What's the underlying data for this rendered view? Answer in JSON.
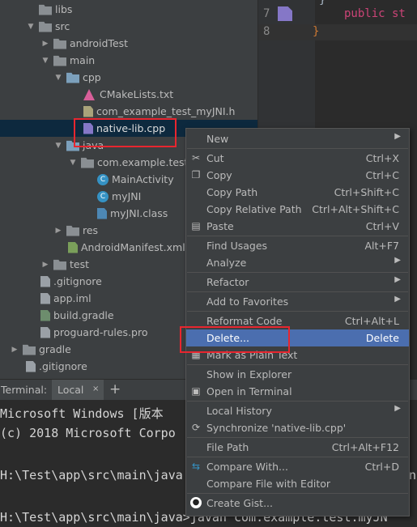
{
  "tree": {
    "items": [
      {
        "label": "libs"
      },
      {
        "label": "src"
      },
      {
        "label": "androidTest"
      },
      {
        "label": "main"
      },
      {
        "label": "cpp"
      },
      {
        "label": "CMakeLists.txt"
      },
      {
        "label": "com_example_test_myJNI.h"
      },
      {
        "label": "native-lib.cpp"
      },
      {
        "label": "java"
      },
      {
        "label": "com.example.test"
      },
      {
        "label": "MainActivity"
      },
      {
        "label": "myJNI"
      },
      {
        "label": "myJNI.class"
      },
      {
        "label": "res"
      },
      {
        "label": "AndroidManifest.xml"
      },
      {
        "label": "test"
      },
      {
        "label": ".gitignore"
      },
      {
        "label": "app.iml"
      },
      {
        "label": "build.gradle"
      },
      {
        "label": "proguard-rules.pro"
      },
      {
        "label": "gradle"
      },
      {
        "label": ".gitignore"
      }
    ]
  },
  "editor": {
    "line_numbers": [
      "7",
      "8"
    ],
    "code_line_7": "public st",
    "code_top": "}",
    "code_line_8": "}"
  },
  "terminal": {
    "label": "Terminal:",
    "tab": "Local",
    "add": "+",
    "lines": [
      "Microsoft Windows [版本",
      "(c) 2018 Microsoft Corpo",
      "",
      "H:\\Test\\app\\src\\main\\java",
      "",
      "H:\\Test\\app\\src\\main\\java>javah com.example.test.myJN"
    ],
    "overlap_char": "n"
  },
  "context_menu": {
    "items": [
      {
        "label": "New",
        "shortcut": "",
        "submenu": true
      },
      {
        "label": "Cut",
        "shortcut": "Ctrl+X",
        "icon": "scissors-icon"
      },
      {
        "label": "Copy",
        "shortcut": "Ctrl+C",
        "icon": "copy-icon"
      },
      {
        "label": "Copy Path",
        "shortcut": "Ctrl+Shift+C"
      },
      {
        "label": "Copy Relative Path",
        "shortcut": "Ctrl+Alt+Shift+C"
      },
      {
        "label": "Paste",
        "shortcut": "Ctrl+V",
        "icon": "paste-icon"
      },
      {
        "label": "Find Usages",
        "shortcut": "Alt+F7"
      },
      {
        "label": "Analyze",
        "shortcut": "",
        "submenu": true
      },
      {
        "label": "Refactor",
        "shortcut": "",
        "submenu": true
      },
      {
        "label": "Add to Favorites",
        "shortcut": "",
        "submenu": true
      },
      {
        "label": "Reformat Code",
        "shortcut": "Ctrl+Alt+L"
      },
      {
        "label": "Delete...",
        "shortcut": "Delete"
      },
      {
        "label": "Mark as Plain Text",
        "shortcut": ""
      },
      {
        "label": "Show in Explorer",
        "shortcut": ""
      },
      {
        "label": "Open in Terminal",
        "shortcut": "",
        "icon": "terminal-icon"
      },
      {
        "label": "Local History",
        "shortcut": "",
        "submenu": true
      },
      {
        "label": "Synchronize 'native-lib.cpp'",
        "shortcut": "",
        "icon": "sync-icon"
      },
      {
        "label": "File Path",
        "shortcut": "Ctrl+Alt+F12"
      },
      {
        "label": "Compare With...",
        "shortcut": "Ctrl+D",
        "icon": "compare-icon"
      },
      {
        "label": "Compare File with Editor",
        "shortcut": ""
      },
      {
        "label": "Create Gist...",
        "shortcut": "",
        "icon": "github-icon"
      }
    ]
  },
  "colors": {
    "highlight": "#4b6eaf",
    "annotation_red": "#e8262f",
    "selected_row": "#0d293e"
  }
}
